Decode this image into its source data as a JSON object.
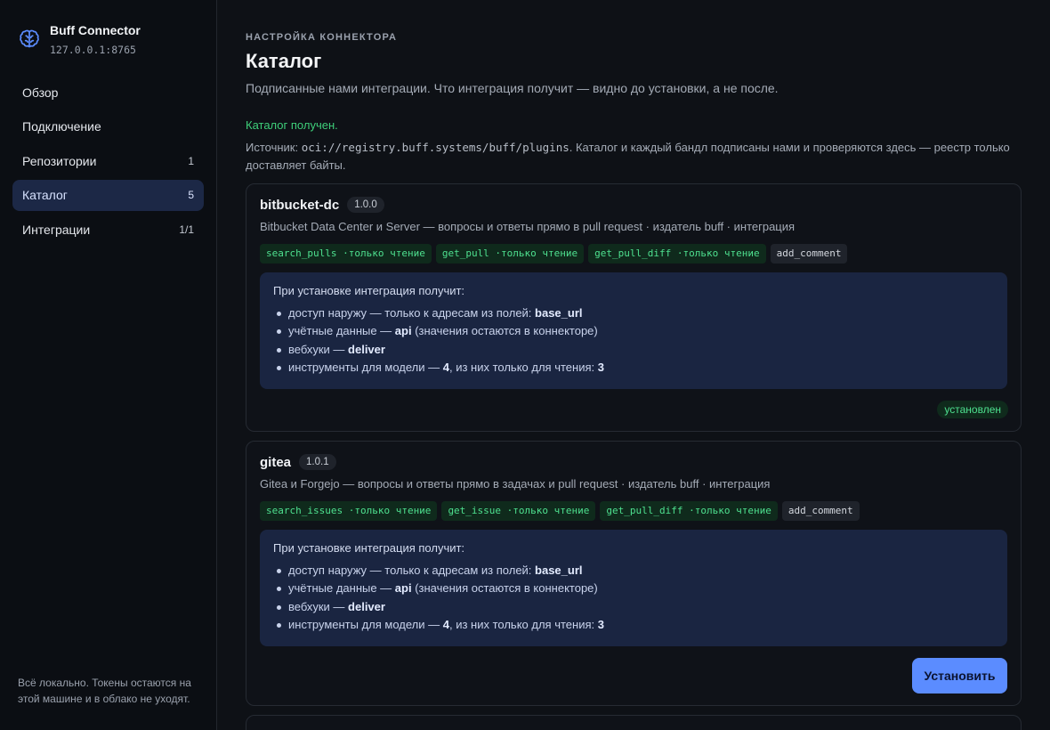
{
  "app": {
    "title": "Buff Connector",
    "address": "127.0.0.1:8765"
  },
  "nav": [
    {
      "label": "Обзор",
      "count": ""
    },
    {
      "label": "Подключение",
      "count": ""
    },
    {
      "label": "Репозитории",
      "count": "1"
    },
    {
      "label": "Каталог",
      "count": "5",
      "active": true
    },
    {
      "label": "Интеграции",
      "count": "1/1"
    }
  ],
  "sidebar_footer": "Всё локально. Токены остаются на этой машине и в облако не уходят.",
  "page": {
    "eyebrow": "НАСТРОЙКА КОННЕКТОРА",
    "title": "Каталог",
    "subtitle": "Подписанные нами интеграции. Что интеграция получит — видно до установки, а не после.",
    "status": "Каталог получен.",
    "source_prefix": "Источник: ",
    "source_url": "oci://registry.buff.systems/buff/plugins",
    "source_suffix": ". Каталог и каждый бандл подписаны нами и проверяются здесь — реестр только доставляет байты."
  },
  "cards": [
    {
      "name": "bitbucket-dc",
      "version": "1.0.0",
      "description": "Bitbucket Data Center и Server — вопросы и ответы прямо в pull request · издатель buff · интеграция",
      "tools": [
        {
          "name": "search_pulls",
          "suffix": " ·только чтение",
          "readonly": true
        },
        {
          "name": "get_pull",
          "suffix": " ·только чтение",
          "readonly": true
        },
        {
          "name": "get_pull_diff",
          "suffix": " ·только чтение",
          "readonly": true
        },
        {
          "name": "add_comment",
          "suffix": "",
          "readonly": false
        }
      ],
      "perm_title": "При установке интеграция получит:",
      "perms": {
        "network_prefix": "доступ наружу — только к адресам из полей: ",
        "network_value": "base_url",
        "creds_prefix": "учётные данные — ",
        "creds_value": "api",
        "creds_suffix": " (значения остаются в коннекторе)",
        "webhooks_prefix": "вебхуки — ",
        "webhooks_value": "deliver",
        "tools_prefix": "инструменты для модели — ",
        "tools_total": "4",
        "tools_mid": ", из них только для чтения: ",
        "tools_readonly": "3"
      },
      "status": "установлен"
    },
    {
      "name": "gitea",
      "version": "1.0.1",
      "description": "Gitea и Forgejo — вопросы и ответы прямо в задачах и pull request · издатель buff · интеграция",
      "tools": [
        {
          "name": "search_issues",
          "suffix": " ·только чтение",
          "readonly": true
        },
        {
          "name": "get_issue",
          "suffix": " ·только чтение",
          "readonly": true
        },
        {
          "name": "get_pull_diff",
          "suffix": " ·только чтение",
          "readonly": true
        },
        {
          "name": "add_comment",
          "suffix": "",
          "readonly": false
        }
      ],
      "perm_title": "При установке интеграция получит:",
      "perms": {
        "network_prefix": "доступ наружу — только к адресам из полей: ",
        "network_value": "base_url",
        "creds_prefix": "учётные данные — ",
        "creds_value": "api",
        "creds_suffix": " (значения остаются в коннекторе)",
        "webhooks_prefix": "вебхуки — ",
        "webhooks_value": "deliver",
        "tools_prefix": "инструменты для модели — ",
        "tools_total": "4",
        "tools_mid": ", из них только для чтения: ",
        "tools_readonly": "3"
      },
      "action": "Установить"
    }
  ],
  "colors": {
    "accent": "#5b8cff",
    "success": "#3ecf7a",
    "active_nav_bg": "#1c2846",
    "perm_bg": "#1a2541"
  },
  "icons": {
    "brand": "brain-icon"
  }
}
